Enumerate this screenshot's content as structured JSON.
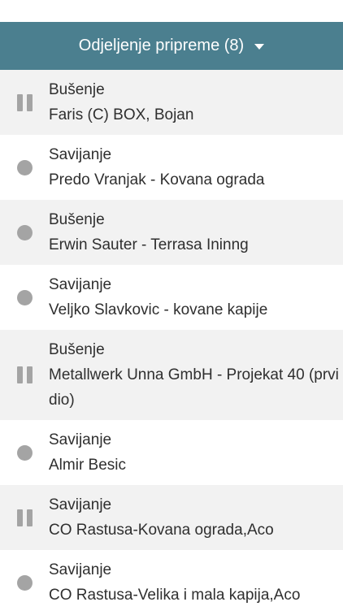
{
  "header": {
    "title": "Odjeljenje pripreme (8)"
  },
  "items": [
    {
      "status_icon": "pause-icon",
      "operation": "Bušenje",
      "order": "Faris (C) BOX, Bojan"
    },
    {
      "status_icon": "circle-icon",
      "operation": "Savijanje",
      "order": "Predo Vranjak - Kovana ograda"
    },
    {
      "status_icon": "circle-icon",
      "operation": "Bušenje",
      "order": "Erwin Sauter - Terrasa Ininng"
    },
    {
      "status_icon": "circle-icon",
      "operation": "Savijanje",
      "order": "Veljko Slavkovic - kovane kapije"
    },
    {
      "status_icon": "pause-icon",
      "operation": "Bušenje",
      "order": "Metallwerk Unna GmbH - Projekat 40 (prvi dio)"
    },
    {
      "status_icon": "circle-icon",
      "operation": "Savijanje",
      "order": "Almir Besic"
    },
    {
      "status_icon": "pause-icon",
      "operation": "Savijanje",
      "order": "CO Rastusa-Kovana ograda,Aco"
    },
    {
      "status_icon": "circle-icon",
      "operation": "Savijanje",
      "order": "CO Rastusa-Velika i mala kapija,Aco"
    }
  ],
  "colors": {
    "header_bg": "#4b7f8f",
    "row_shade": "#f2f2f2",
    "icon_gray": "#a4a4a4"
  }
}
